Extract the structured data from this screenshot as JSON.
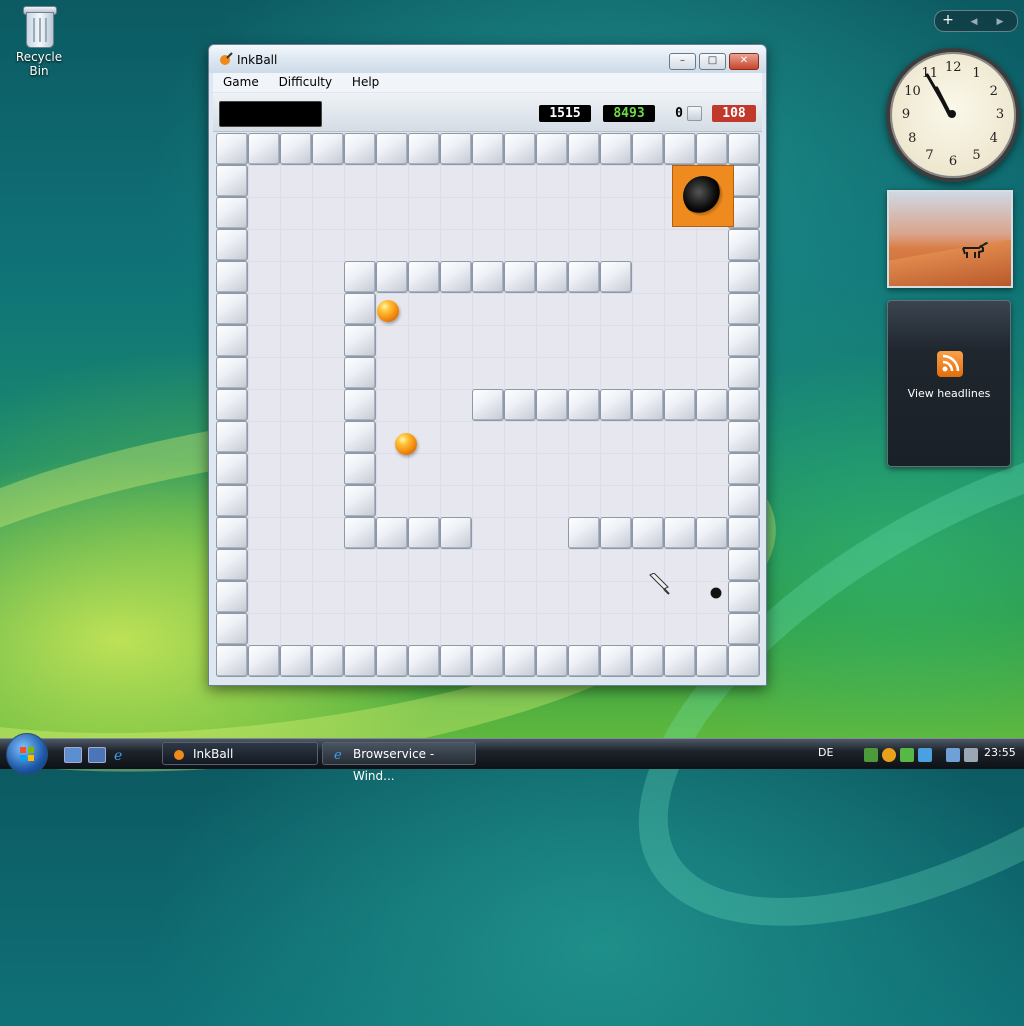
{
  "desktop": {
    "recycle_bin_label": "Recycle Bin"
  },
  "window": {
    "title": "InkBall",
    "menu": [
      "Game",
      "Difficulty",
      "Help"
    ],
    "controls": {
      "minimize": "–",
      "maximize": "□",
      "close": "✕"
    }
  },
  "hud": {
    "score": "1515",
    "high_score": "8493",
    "balls_count": "0",
    "time_left": "108"
  },
  "gadgets": {
    "sidebar_add": "+",
    "sidebar_prev": "◀",
    "sidebar_next": "▶",
    "clock_numbers": [
      "12",
      "1",
      "2",
      "3",
      "4",
      "5",
      "6",
      "7",
      "8",
      "9",
      "10",
      "11"
    ],
    "feed_text": "View headlines"
  },
  "taskbar": {
    "tasks": [
      "InkBall",
      "Browservice - Wind..."
    ],
    "language": "DE",
    "time": "23:55"
  },
  "colors": {
    "score_bg": "#000000",
    "high_score_fg": "#6ddc4a",
    "time_bg": "#c0392b",
    "goal_orange": "#ef8a1f",
    "ball_orange": "#f28a10"
  }
}
